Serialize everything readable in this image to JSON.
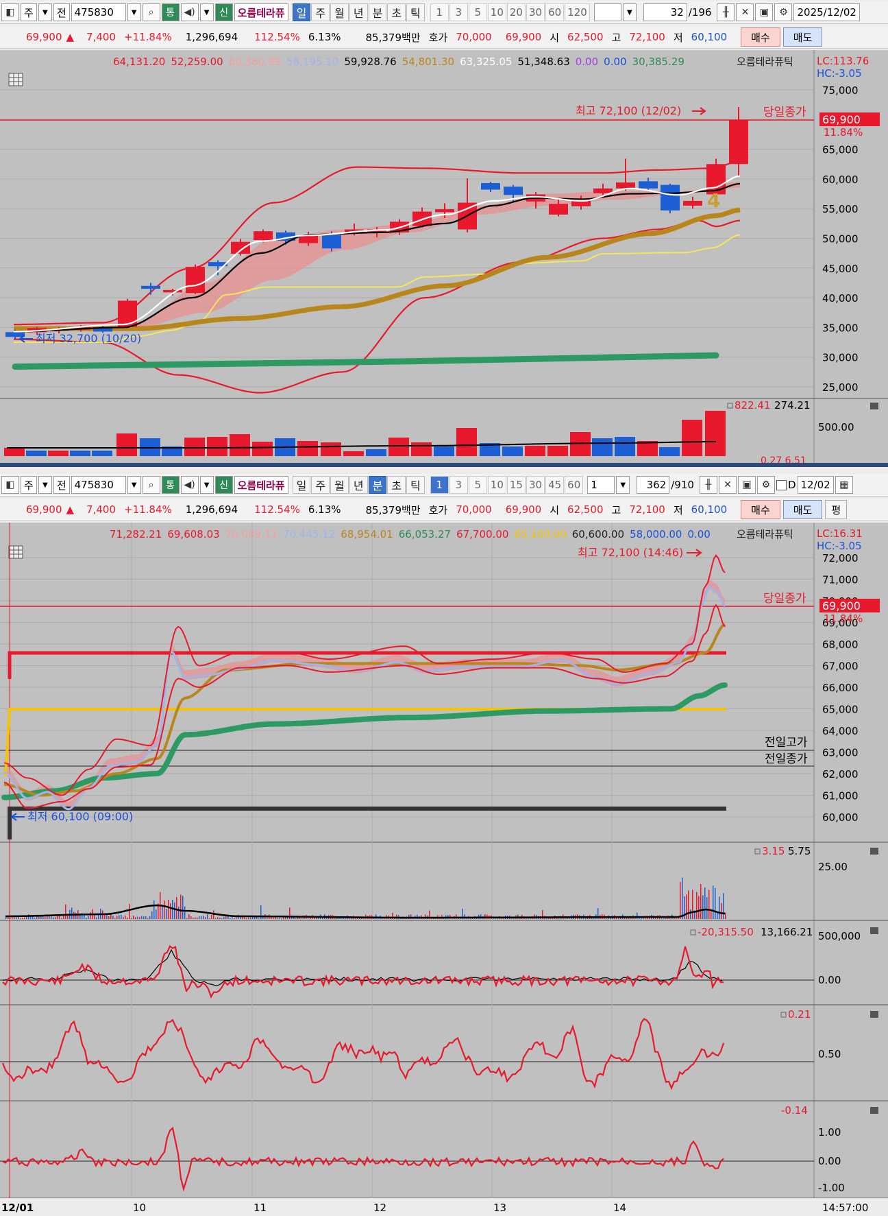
{
  "daily_toolbar": {
    "market": "주",
    "prev": "전",
    "code": "475830",
    "tong": "통",
    "sin": "신",
    "name": "오름테라퓨",
    "periods": [
      "일",
      "주",
      "월",
      "년",
      "분",
      "초",
      "틱"
    ],
    "active_period": "일",
    "nums": [
      "1",
      "3",
      "5",
      "10",
      "20",
      "30",
      "60",
      "120"
    ],
    "count": "32",
    "total": "/196",
    "date": "2025/12/02"
  },
  "daily_quote": {
    "price": "69,900",
    "arrow": "▲",
    "change": "7,400",
    "pct": "+11.84%",
    "volume": "1,296,694",
    "vol_ratio": "112.54%",
    "turnover": "6.13%",
    "amount": "85,379백만",
    "hoga_label": "호가",
    "ask": "70,000",
    "bid": "69,900",
    "open_label": "시",
    "open": "62,500",
    "high_label": "고",
    "high": "72,100",
    "low_label": "저",
    "low": "60,100",
    "buy": "매수",
    "sell": "매도"
  },
  "daily_chart": {
    "legend": [
      {
        "t": "64,131.20",
        "c": "#e8192c"
      },
      {
        "t": "52,259.00",
        "c": "#e8192c"
      },
      {
        "t": "60,360.99",
        "c": "#f2a0a0"
      },
      {
        "t": "58,195.10",
        "c": "#9fb4e8"
      },
      {
        "t": "59,928.76",
        "c": "#000000"
      },
      {
        "t": "54,801.30",
        "c": "#b8861b"
      },
      {
        "t": "63,325.05",
        "c": "#ffffff"
      },
      {
        "t": "51,348.63",
        "c": "#000000"
      },
      {
        "t": "0.00",
        "c": "#a040e0"
      },
      {
        "t": "0.00",
        "c": "#1c4fd8"
      },
      {
        "t": "30,385.29",
        "c": "#2e8b57"
      }
    ],
    "stock_name": "오름테라퓨틱",
    "lc": "LC:113.76",
    "hc": "HC:-3.05",
    "y_ticks": [
      "75,000",
      "70,000",
      "65,000",
      "60,000",
      "55,000",
      "50,000",
      "45,000",
      "40,000",
      "35,000",
      "30,000",
      "25,000"
    ],
    "hi_label": "최고 72,100 (12/02)",
    "lo_label": "최저 32,700 (10/20)",
    "close_label": "당일종가",
    "close_value": "69,900",
    "close_pct": "11.84%",
    "mark4": "4",
    "vol_legend": {
      "a": "822.41",
      "b": "274.21"
    },
    "vol_tick": "500.00",
    "vol_cut": "0.27  6.51"
  },
  "minute_toolbar": {
    "market": "주",
    "prev": "전",
    "code": "475830",
    "tong": "통",
    "sin": "신",
    "name": "오름테라퓨",
    "periods": [
      "일",
      "주",
      "월",
      "년",
      "분",
      "초",
      "틱"
    ],
    "active_period": "분",
    "nums": [
      "1",
      "3",
      "5",
      "10",
      "15",
      "30",
      "45",
      "60"
    ],
    "active_num": "1",
    "interval": "1",
    "count": "362",
    "total": "/910",
    "check": "D",
    "date": "12/02"
  },
  "minute_quote": {
    "price": "69,900",
    "arrow": "▲",
    "change": "7,400",
    "pct": "+11.84%",
    "volume": "1,296,694",
    "vol_ratio": "112.54%",
    "turnover": "6.13%",
    "amount": "85,379백만",
    "hoga_label": "호가",
    "ask": "70,000",
    "bid": "69,900",
    "open_label": "시",
    "open": "62,500",
    "high_label": "고",
    "high": "72,100",
    "low_label": "저",
    "low": "60,100",
    "buy": "매수",
    "sell": "매도",
    "pyeong": "평"
  },
  "minute_chart": {
    "legend": [
      {
        "t": "71,282.21",
        "c": "#e8192c"
      },
      {
        "t": "69,608.03",
        "c": "#e8192c"
      },
      {
        "t": "70,089.11",
        "c": "#f2a0a0"
      },
      {
        "t": "70,445.12",
        "c": "#9fb4e8"
      },
      {
        "t": "68,954.01",
        "c": "#b8861b"
      },
      {
        "t": "66,053.27",
        "c": "#2e8b57"
      },
      {
        "t": "67,700.00",
        "c": "#e8192c"
      },
      {
        "t": "65,100.00",
        "c": "#f5c400"
      },
      {
        "t": "60,600.00",
        "c": "#222222"
      },
      {
        "t": "58,000.00",
        "c": "#1c4fd8"
      },
      {
        "t": "0.00",
        "c": "#1c4fd8"
      }
    ],
    "stock_name": "오름테라퓨틱",
    "lc": "LC:16.31",
    "hc": "HC:-3.05",
    "y_ticks": [
      "72,000",
      "71,000",
      "70,000",
      "69,000",
      "68,000",
      "67,000",
      "66,000",
      "65,000",
      "64,000",
      "63,000",
      "62,000",
      "61,000",
      "60,000"
    ],
    "hi_label": "최고 72,100 (14:46)",
    "lo_label": "최저 60,100 (09:00)",
    "close_label": "당일종가",
    "close_value": "69,900",
    "close_pct": "11.84%",
    "prev_high": "전일고가",
    "prev_close": "전일종가",
    "vol": {
      "a": "3.15",
      "b": "5.75",
      "tick": "25.00"
    },
    "ind1": {
      "a": "-20,315.50",
      "b": "13,166.21",
      "ticks": [
        "500,000",
        "0.00"
      ]
    },
    "ind2": {
      "a": "0.21",
      "ticks": [
        "0.50"
      ]
    },
    "ind3": {
      "a": "-0.14",
      "ticks": [
        "1.00",
        "0.00",
        "-1.00"
      ]
    },
    "x_labels": [
      "12/01",
      "10",
      "11",
      "12",
      "13",
      "14"
    ],
    "time": "14:57:00"
  }
}
